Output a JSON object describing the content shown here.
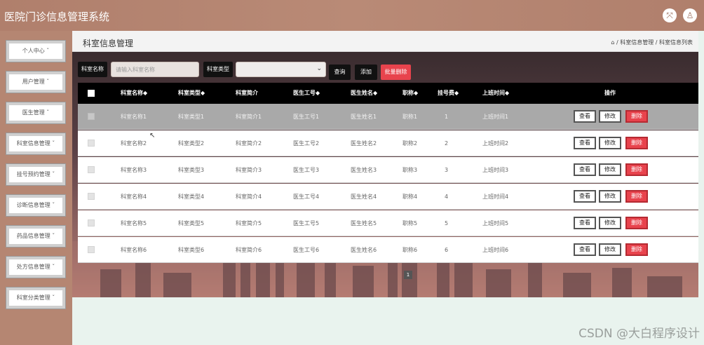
{
  "app": {
    "title": "医院门诊信息管理系统"
  },
  "header_icons": [
    "expand-icon",
    "user-icon"
  ],
  "sidebar": {
    "items": [
      {
        "label": "个人中心 ˇ"
      },
      {
        "label": "用户管理 ˇ"
      },
      {
        "label": "医生管理 ˇ"
      },
      {
        "label": "科室信息管理 ˇ"
      },
      {
        "label": "挂号预约管理 ˇ"
      },
      {
        "label": "诊断信息管理 ˇ"
      },
      {
        "label": "药品信息管理 ˇ"
      },
      {
        "label": "处方信息管理 ˇ"
      },
      {
        "label": "科室分类管理 ˇ"
      }
    ]
  },
  "page": {
    "title": "科室信息管理",
    "breadcrumb": "⌂ / 科室信息管理 / 科室信息列表"
  },
  "toolbar": {
    "name_label": "科室名称",
    "name_placeholder": "请输入科室名称",
    "type_label": "科室类型",
    "type_value": "",
    "search_label": "查询",
    "add_label": "添加",
    "batch_delete_label": "批量删除"
  },
  "table": {
    "headers": [
      "科室名称◆",
      "科室类型◆",
      "科室简介",
      "医生工号◆",
      "医生姓名◆",
      "职称◆",
      "挂号费◆",
      "上班时间◆",
      "操作"
    ],
    "rows": [
      [
        "科室名称1",
        "科室类型1",
        "科室简介1",
        "医生工号1",
        "医生姓名1",
        "职称1",
        "1",
        "上班时间1"
      ],
      [
        "科室名称2",
        "科室类型2",
        "科室简介2",
        "医生工号2",
        "医生姓名2",
        "职称2",
        "2",
        "上班时间2"
      ],
      [
        "科室名称3",
        "科室类型3",
        "科室简介3",
        "医生工号3",
        "医生姓名3",
        "职称3",
        "3",
        "上班时间3"
      ],
      [
        "科室名称4",
        "科室类型4",
        "科室简介4",
        "医生工号4",
        "医生姓名4",
        "职称4",
        "4",
        "上班时间4"
      ],
      [
        "科室名称5",
        "科室类型5",
        "科室简介5",
        "医生工号5",
        "医生姓名5",
        "职称5",
        "5",
        "上班时间5"
      ],
      [
        "科室名称6",
        "科室类型6",
        "科室简介6",
        "医生工号6",
        "医生姓名6",
        "职称6",
        "6",
        "上班时间6"
      ]
    ],
    "actions": {
      "view": "查看",
      "edit": "修改",
      "delete": "删除"
    },
    "selected_row": 0
  },
  "pager": {
    "current": "1"
  },
  "watermark": "CSDN @大白程序设计",
  "colors": {
    "accent": "#e8434d",
    "sidebar": "#b58672",
    "header": "#b07f6c"
  }
}
